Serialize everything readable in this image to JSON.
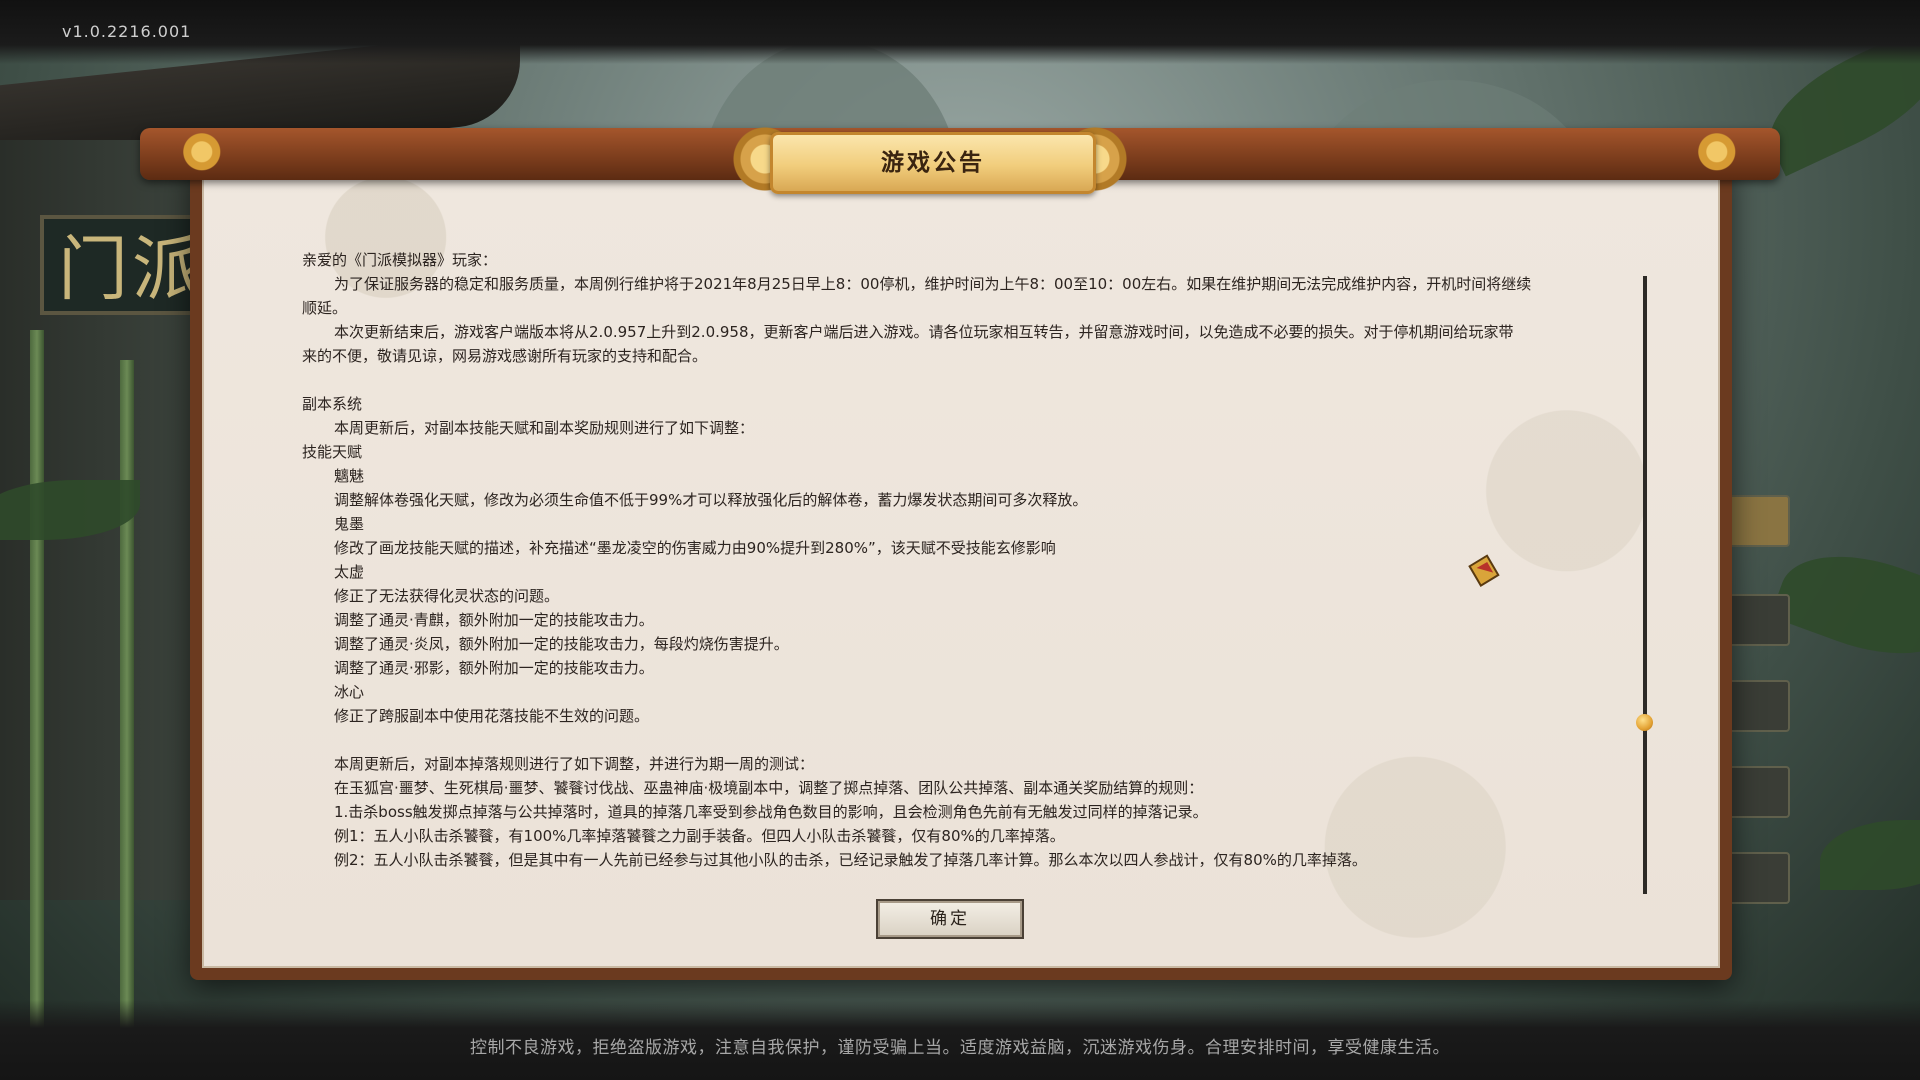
{
  "version": "v1.0.2216.001",
  "dialog": {
    "title": "游戏公告",
    "ok_label": "确定",
    "lines": [
      "亲爱的《门派模拟器》玩家：",
      "为了保证服务器的稳定和服务质量，本周例行维护将于2021年8月25日早上8：00停机，维护时间为上午8：00至10：00左右。如果在维护期间无法完成维护内容，开机时间将继续",
      "顺延。",
      "本次更新结束后，游戏客户端版本将从2.0.957上升到2.0.958，更新客户端后进入游戏。请各位玩家相互转告，并留意游戏时间，以免造成不必要的损失。对于停机期间给玩家带",
      "来的不便，敬请见谅，网易游戏感谢所有玩家的支持和配合。",
      "",
      "副本系统",
      "本周更新后，对副本技能天赋和副本奖励规则进行了如下调整：",
      "技能天赋",
      "魑魅",
      "调整解体卷强化天赋，修改为必须生命值不低于99%才可以释放强化后的解体卷，蓄力爆发状态期间可多次释放。",
      "鬼墨",
      "修改了画龙技能天赋的描述，补充描述“墨龙凌空的伤害威力由90%提升到280%”，该天赋不受技能玄修影响",
      "太虚",
      "修正了无法获得化灵状态的问题。",
      "调整了通灵·青麒，额外附加一定的技能攻击力。",
      "调整了通灵·炎凤，额外附加一定的技能攻击力，每段灼烧伤害提升。",
      "调整了通灵·邪影，额外附加一定的技能攻击力。",
      "冰心",
      "修正了跨服副本中使用花落技能不生效的问题。",
      "",
      "本周更新后，对副本掉落规则进行了如下调整，并进行为期一周的测试：",
      "在玉狐宫·噩梦、生死棋局·噩梦、饕餮讨伐战、巫蛊神庙·极境副本中，调整了掷点掉落、团队公共掉落、副本通关奖励结算的规则：",
      "1.击杀boss触发掷点掉落与公共掉落时，道具的掉落几率受到参战角色数目的影响，且会检测角色先前有无触发过同样的掉落记录。",
      "例1：五人小队击杀饕餮，有100%几率掉落饕餮之力副手装备。但四人小队击杀饕餮，仅有80%的几率掉落。",
      "例2：五人小队击杀饕餮，但是其中有一人先前已经参与过其他小队的击杀，已经记录触发了掉落几率计算。那么本次以四人参战计，仅有80%的几率掉落。"
    ]
  },
  "footer": "控制不良游戏，拒绝盗版游戏，注意自我保护，谨防受骗上当。适度游戏益脑，沉迷游戏伤身。合理安排时间，享受健康生活。",
  "background": {
    "sign_text": "门派"
  }
}
